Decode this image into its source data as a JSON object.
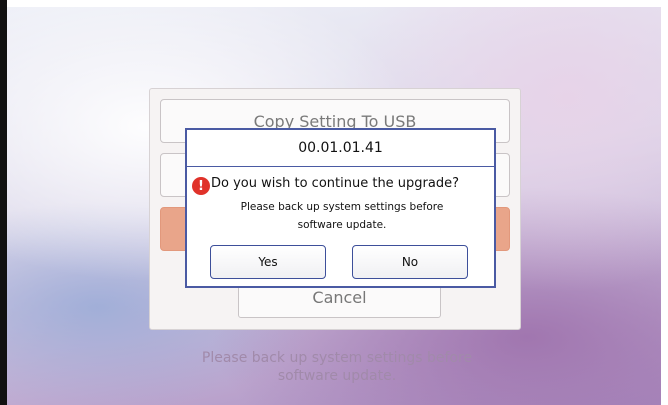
{
  "menu": {
    "copy_setting_label": "Copy Setting To USB",
    "cancel_label": "Cancel"
  },
  "bottom_note": {
    "line1": "Please back up system settings before",
    "line2": "software update."
  },
  "dialog": {
    "title": "00.01.01.41",
    "question": "Do you wish to continue the upgrade?",
    "detail_line1": "Please back up system settings before",
    "detail_line2": "software update.",
    "warning_icon": "exclamation-icon",
    "yes_label": "Yes",
    "no_label": "No"
  },
  "colors": {
    "dialog_border": "#4a5aa3",
    "highlight_button": "#e9a58a",
    "warning": "#e0322a"
  }
}
